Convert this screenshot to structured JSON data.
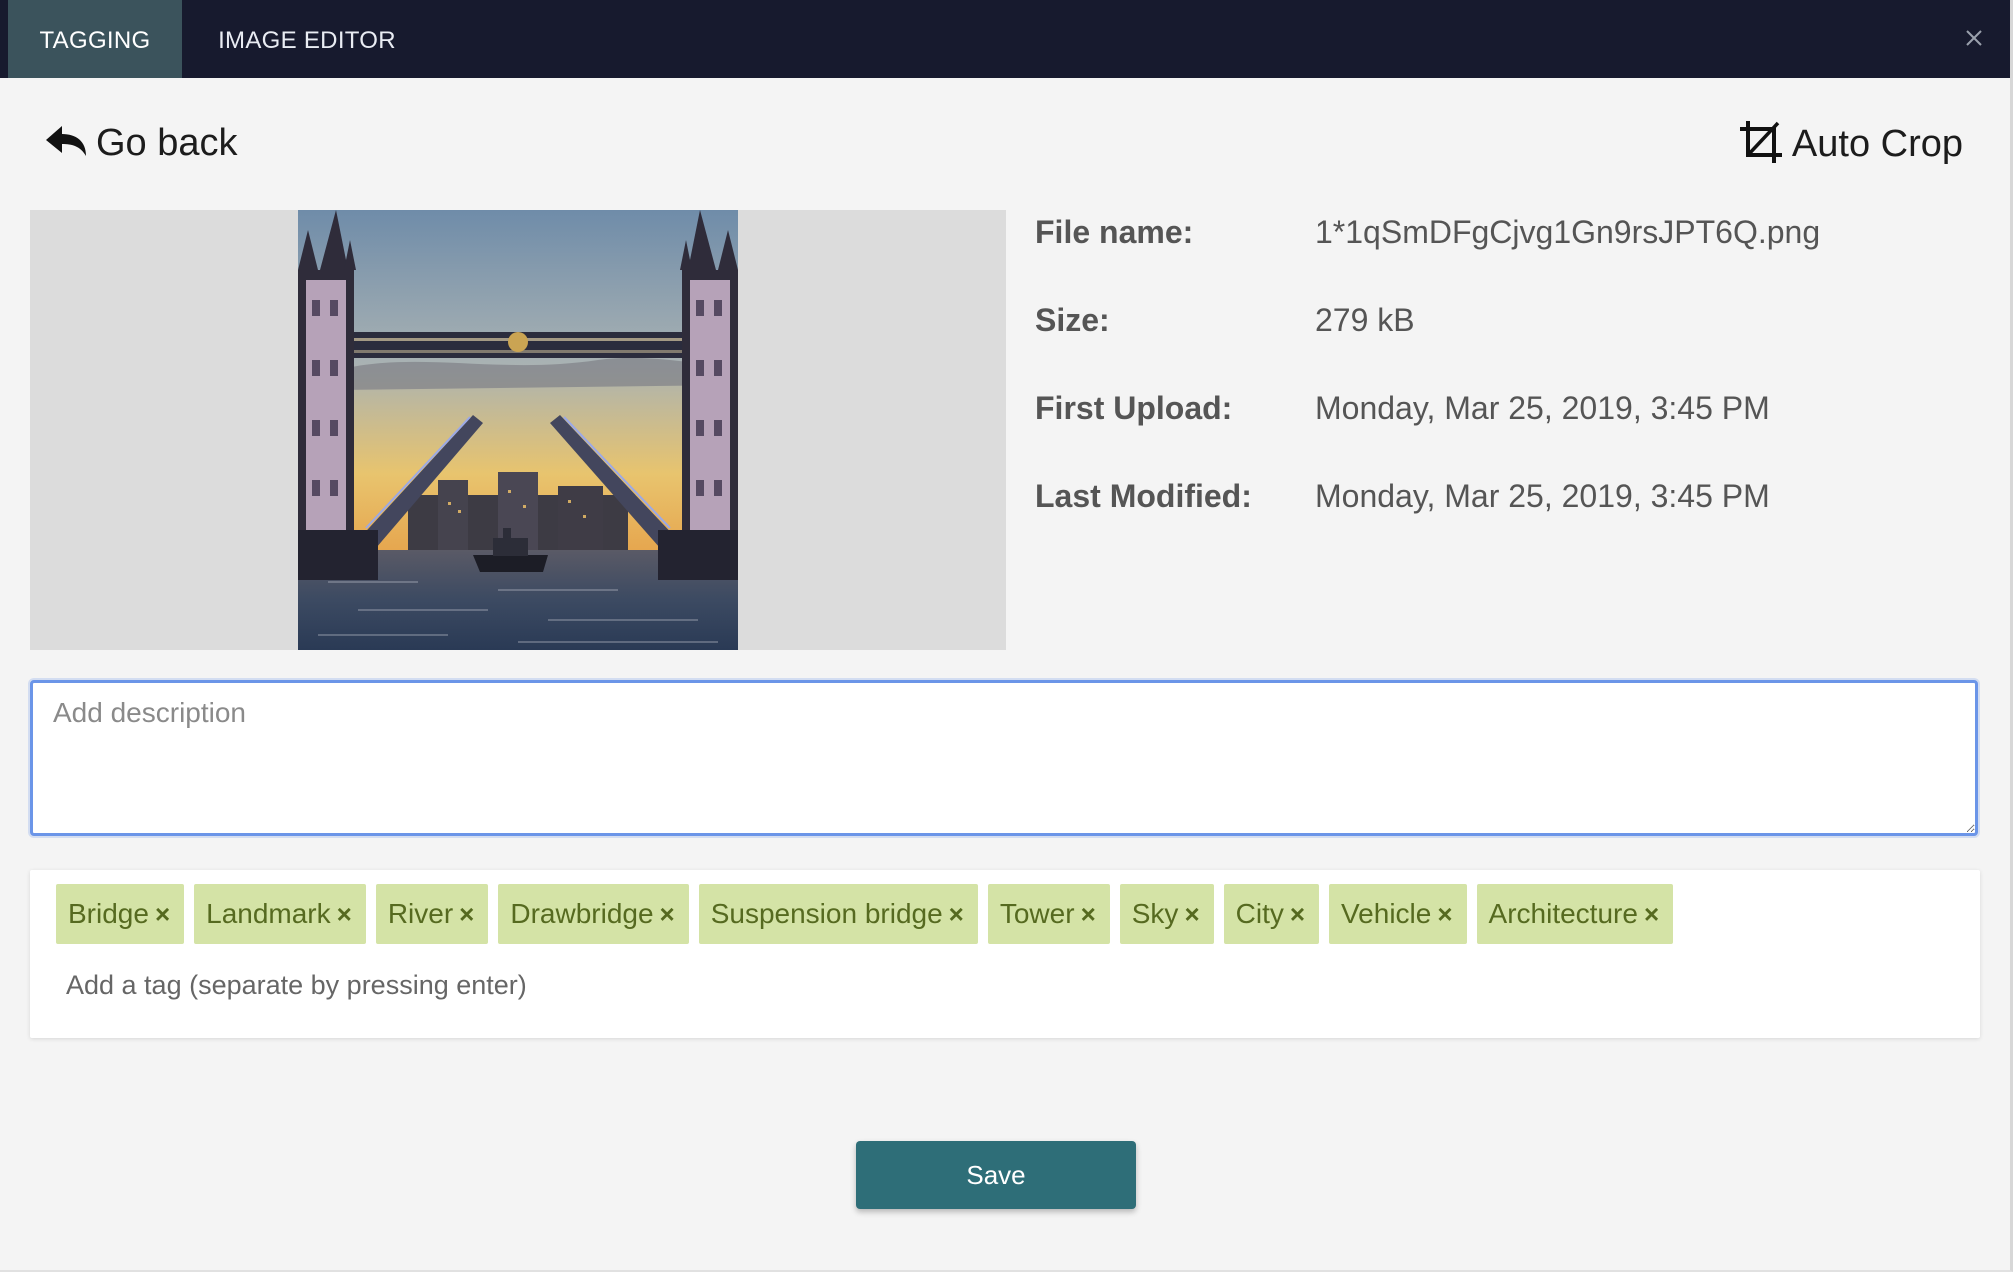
{
  "tabs": [
    {
      "label": "Tagging",
      "active": true
    },
    {
      "label": "Image Editor",
      "active": false
    }
  ],
  "close_icon": "close-icon",
  "header": {
    "go_back_label": "Go back",
    "go_back_icon": "reply-arrow-icon",
    "auto_crop_label": "Auto Crop",
    "auto_crop_icon": "crop-icon"
  },
  "image": {
    "subject": "Tower Bridge with raised bascules at sunset"
  },
  "meta": {
    "file_name_label": "File name:",
    "file_name": "1*1qSmDFgCjvg1Gn9rsJPT6Q.png",
    "size_label": "Size:",
    "size": "279 kB",
    "first_upload_label": "First Upload:",
    "first_upload": "Monday, Mar 25, 2019, 3:45 PM",
    "last_modified_label": "Last Modified:",
    "last_modified": "Monday, Mar 25, 2019, 3:45 PM"
  },
  "description": {
    "value": "",
    "placeholder": "Add description"
  },
  "tags": {
    "items": [
      "Bridge",
      "Landmark",
      "River",
      "Drawbridge",
      "Suspension bridge",
      "Tower",
      "Sky",
      "City",
      "Vehicle",
      "Architecture"
    ],
    "remove_glyph": "×",
    "input_placeholder": "Add a tag (separate by pressing enter)"
  },
  "save_label": "Save",
  "colors": {
    "topbar": "#171a2e",
    "active_tab": "#3b535c",
    "tag_bg": "#d4e3a6",
    "tag_text": "#566a20",
    "save_bg": "#2e6e78",
    "focus_border": "#6b95e8"
  }
}
